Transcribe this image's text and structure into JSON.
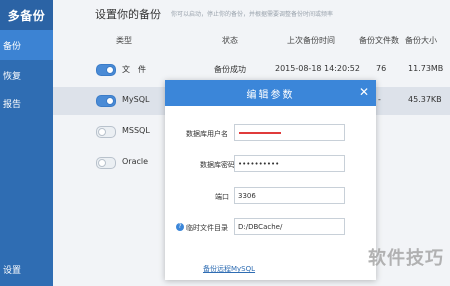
{
  "sidebar": {
    "brand": "多备份",
    "items": [
      {
        "label": "备份"
      },
      {
        "label": "恢复"
      },
      {
        "label": "报告"
      }
    ],
    "bottom": "设置"
  },
  "main": {
    "title": "设置你的备份",
    "note": "你可以启动，停止你的备份，并根据需要调整备份时间或频率"
  },
  "table": {
    "headers": [
      "类型",
      "状态",
      "上次备份时间",
      "备份文件数",
      "备份大小"
    ],
    "rows": [
      {
        "type": "文　件",
        "status": "备份成功",
        "time": "2015-08-18 14:20:52",
        "count": "76",
        "size": "11.73MB",
        "enabled": true
      },
      {
        "type": "MySQL",
        "status": "",
        "time": "",
        "count": "-",
        "size": "45.37KB",
        "enabled": true
      },
      {
        "type": "MSSQL",
        "status": "",
        "time": "",
        "count": "",
        "size": "",
        "enabled": false
      },
      {
        "type": "Oracle",
        "status": "",
        "time": "",
        "count": "",
        "size": "",
        "enabled": false
      }
    ]
  },
  "modal": {
    "title": "编辑参数",
    "fields": {
      "username_label": "数据库用户名",
      "password_label": "数据库密码",
      "password_value": "••••••••••",
      "port_label": "端口",
      "port_value": "3306",
      "tempdir_label": "临时文件目录",
      "tempdir_value": "D:/DBCache/"
    },
    "link": "备份远程MySQL"
  },
  "watermark": "软件技巧",
  "colors": {
    "sidebar": "#2f6db3",
    "sidebar_active": "#3c83d3",
    "modal_header": "#3b86d9",
    "toggle_on": "#4a8bd6",
    "redaction": "#e03b3b"
  }
}
